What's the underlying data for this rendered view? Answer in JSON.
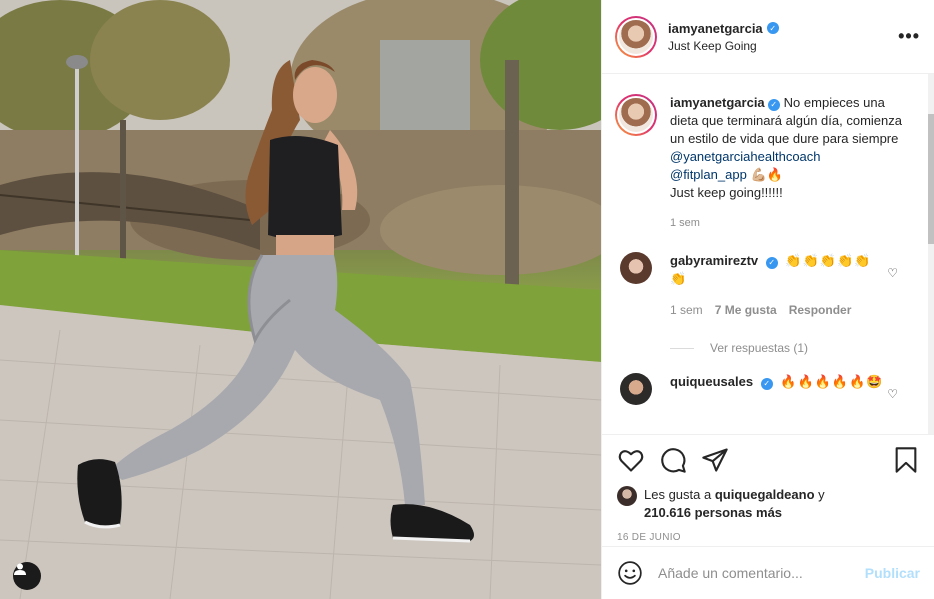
{
  "post": {
    "username": "iamyanetgarcia",
    "subtitle": "Just Keep Going",
    "more_label": "•••"
  },
  "caption": {
    "username": "iamyanetgarcia",
    "text": "No empieces una dieta que terminará algún día, comienza un estilo de vida que dure para siempre",
    "mention1": "@yanetgarciahealthcoach",
    "mention2": "@fitplan_app",
    "mention2_emoji": "💪🏼🔥",
    "closing": "Just keep going!!!!!!",
    "time": "1 sem"
  },
  "comments": [
    {
      "username": "gabyramireztv",
      "text": "👏👏👏👏👏👏",
      "time": "1 sem",
      "likes": "7 Me gusta",
      "reply": "Responder",
      "view_replies": "Ver respuestas (1)"
    },
    {
      "username": "quiqueusales",
      "text": "🔥🔥🔥🔥🔥🤩"
    }
  ],
  "likes": {
    "prefix": "Les gusta a",
    "liker": "quiquegaldeano",
    "conj": "y",
    "count": "210.616 personas más"
  },
  "date": "16 DE JUNIO",
  "add_comment": {
    "placeholder": "Añade un comentario...",
    "publish": "Publicar"
  },
  "colors": {
    "verified": "#3897f0",
    "link": "#00376b",
    "publish_disabled": "#b2dffc"
  },
  "icons": [
    "heart-icon",
    "comment-icon",
    "share-icon",
    "bookmark-icon",
    "smile-icon",
    "tag-user-icon",
    "verified-icon"
  ]
}
